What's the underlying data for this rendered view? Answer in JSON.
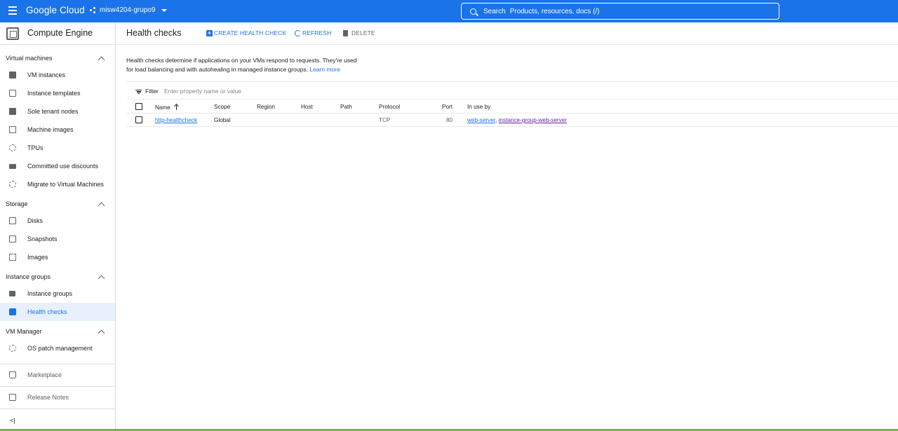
{
  "topbar": {
    "logo": "Google Cloud",
    "project": "misw4204-grupo9",
    "search_label": "Search",
    "search_placeholder": "Products, resources, docs (/)"
  },
  "sidebar": {
    "product": "Compute Engine",
    "sections": [
      {
        "title": "Virtual machines",
        "items": [
          "VM instances",
          "Instance templates",
          "Sole tenant nodes",
          "Machine images",
          "TPUs",
          "Committed use discounts",
          "Migrate to Virtual Machines"
        ]
      },
      {
        "title": "Storage",
        "items": [
          "Disks",
          "Snapshots",
          "Images"
        ]
      },
      {
        "title": "Instance groups",
        "items": [
          "Instance groups",
          "Health checks"
        ]
      },
      {
        "title": "VM Manager",
        "items": [
          "OS patch management"
        ]
      }
    ],
    "footer": [
      "Marketplace",
      "Release Notes"
    ],
    "collapse": "<|"
  },
  "toolbar": {
    "title": "Health checks",
    "create": "CREATE HEALTH CHECK",
    "refresh": "REFRESH",
    "delete": "DELETE"
  },
  "description": {
    "text": "Health checks determine if applications on your VMs respond to requests. They're used for load balancing and with autohealing in managed instance groups.",
    "link": "Learn more"
  },
  "filter": {
    "label": "Filter",
    "placeholder": "Enter property name or value"
  },
  "table": {
    "columns": [
      "Name",
      "Scope",
      "Region",
      "Host",
      "Path",
      "Protocol",
      "Port",
      "In use by"
    ],
    "rows": [
      {
        "name": "http-healthcheck",
        "scope": "Global",
        "region": "",
        "host": "",
        "path": "",
        "protocol": "TCP",
        "port": "80",
        "in_use_by_1": "web-server",
        "separator": ", ",
        "in_use_by_2": "instance-group-web-server"
      }
    ]
  }
}
